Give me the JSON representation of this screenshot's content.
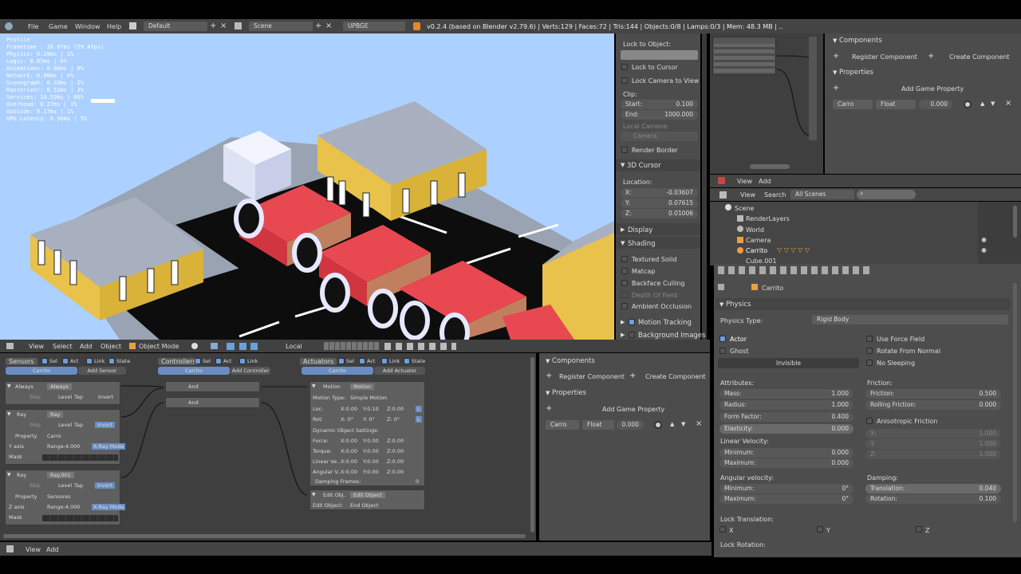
{
  "menubar": {
    "items": [
      "File",
      "Game",
      "Window",
      "Help"
    ],
    "layout": "Default",
    "scene": "Scene",
    "engine": "UPBGE",
    "info": "v0.2.4 (based on Blender v2.79.6) | Verts:129 | Faces:72 | Tris:144 | Objects:0/8 | Lamps:0/3 | Mem: 48.3 MB | .."
  },
  "profile": {
    "title": "Profile",
    "rows": [
      "Frametime : 16.87ms (59.4fps)",
      "Physics:     0.20ms | 1%",
      "Logic:       0.07ms | 0%",
      "Animations:  0.00ms | 0%",
      "Network:     0.00ms | 0%",
      "Scenegraph:  0.33ms | 2%",
      "Rasterizer:  0.52ms | 3%",
      "Services:   14.53ms | 86%",
      "Overhead:    0.27ms | 1%",
      "Outside:     0.17ms | 1%",
      "GPU Latency: 0.90ms | 5%"
    ],
    "services_fraction": 0.86
  },
  "viewport_header": {
    "items": [
      "View",
      "Select",
      "Add",
      "Object"
    ],
    "mode": "Object Mode",
    "pivot": "Local"
  },
  "props_panel": {
    "lock_to_object": "Lock to Object:",
    "lock_to_cursor": "Lock to Cursor",
    "lock_camera": "Lock Camera to View",
    "clip": "Clip:",
    "start_label": "Start:",
    "start_value": "0.100",
    "end_label": "End:",
    "end_value": "1000.000",
    "local_camera": "Local Camera:",
    "camera": "Camera",
    "render_border": "Render Border",
    "cursor_header": "3D Cursor",
    "location": "Location:",
    "x_label": "X:",
    "x_value": "-0.03607",
    "y_label": "Y:",
    "y_value": "0.07615",
    "z_label": "Z:",
    "z_value": "0.01006",
    "display": "Display",
    "shading": "Shading",
    "textured_solid": "Textured Solid",
    "matcap": "Matcap",
    "backface": "Backface Culling",
    "dof": "Depth Of Field",
    "ao": "Ambient Occlusion",
    "motion_tracking": "Motion Tracking",
    "background_images": "Background Images"
  },
  "components_top": {
    "title": "Components",
    "register": "Register Component",
    "create": "Create Component",
    "properties": "Properties",
    "add_prop": "Add Game Property",
    "prop_name": "Carro",
    "prop_type": "Float",
    "prop_value": "0.000"
  },
  "outliner": {
    "menu": [
      "View",
      "Add"
    ],
    "menu2": [
      "View",
      "Search"
    ],
    "scope": "All Scenes",
    "items": [
      "Scene",
      "RenderLayers",
      "World",
      "Camera",
      "Carrito",
      "Cube.001"
    ]
  },
  "logic": {
    "sensors": "Sensors",
    "controllers": "Controllers",
    "actuators": "Actuators",
    "sel": "Sel",
    "act": "Act",
    "link": "Link",
    "state": "State",
    "obj": "Carrito",
    "add_sensor": "Add Sensor",
    "add_controller": "Add Controller",
    "add_actuator": "Add Actuator",
    "always": "Always",
    "ray": "Ray",
    "ray2": "Ray",
    "ray_name": "Ray.001",
    "level": "Level",
    "tap": "Tap",
    "invert": "Invert",
    "property": "Property",
    "carro": "Carro",
    "sensores": "Sensores",
    "yaxis": "Y axis",
    "zaxis": "Z axis",
    "range": "Range:4.000",
    "xray": "X-Ray Mode",
    "mask": "Mask",
    "skip": "Skip",
    "and": "And",
    "motion": "Motion",
    "motion_type": "Motion Type:",
    "simple_motion": "Simple Motion",
    "loc": "Loc:",
    "rot": "Rot:",
    "dyn": "Dynamic Object Settings:",
    "force": "Force:",
    "torque": "Torque:",
    "linvel": "Linear Ve..",
    "angvel": "Angular V..",
    "damping": "Damping Frames:",
    "damp_val": "0",
    "edit_obj": "Edit Obj..",
    "edit_object": "Edit Object",
    "edit_object_label": "Edit Object:",
    "end_object": "End Object",
    "x0": "X:0.00",
    "y0": "Y:0.00",
    "z0": "Z:0.00",
    "y010": "Y:0.10",
    "x0d": "X: 0°",
    "y0d": "Y: 0°",
    "z0d": "Z: 0°"
  },
  "components_mid": {
    "title": "Components",
    "register": "Register Component",
    "create": "Create Component",
    "properties": "Properties",
    "add_prop": "Add Game Property",
    "prop_name": "Carro",
    "prop_type": "Float",
    "prop_value": "0.000"
  },
  "physics": {
    "object": "Carrito",
    "header": "Physics",
    "type_label": "Physics Type:",
    "type_value": "Rigid Body",
    "actor": "Actor",
    "ghost": "Ghost",
    "invisible": "Invisible",
    "use_force": "Use Force Field",
    "rotate_normal": "Rotate From Normal",
    "no_sleeping": "No Sleeping",
    "attributes": "Attributes:",
    "mass_l": "Mass:",
    "mass_v": "1.000",
    "radius_l": "Radius:",
    "radius_v": "1.000",
    "form_l": "Form Factor:",
    "form_v": "0.400",
    "elast_l": "Elasticity:",
    "elast_v": "0.000",
    "friction": "Friction:",
    "fric_l": "Friction:",
    "fric_v": "0.500",
    "roll_l": "Rolling Friction:",
    "roll_v": "0.000",
    "aniso": "Anisotropic Friction",
    "ax": "X:",
    "ay": "Y:",
    "az": "Z:",
    "av": "1.000",
    "linvel": "Linear Velocity:",
    "min_l": "Minimum:",
    "min_v": "0.000",
    "max_l": "Maximum:",
    "max_v": "0.000",
    "angvel": "Angular velocity:",
    "amin_v": "0°",
    "amax_v": "0°",
    "damping": "Damping:",
    "trans_l": "Translation:",
    "trans_v": "0.040",
    "rot_l": "Rotation:",
    "rot_v": "0.100",
    "lock_trans": "Lock Translation:",
    "lock_rot": "Lock Rotation:",
    "x": "X",
    "y": "Y",
    "z": "Z"
  },
  "bottom": {
    "items": [
      "View",
      "Add"
    ]
  }
}
